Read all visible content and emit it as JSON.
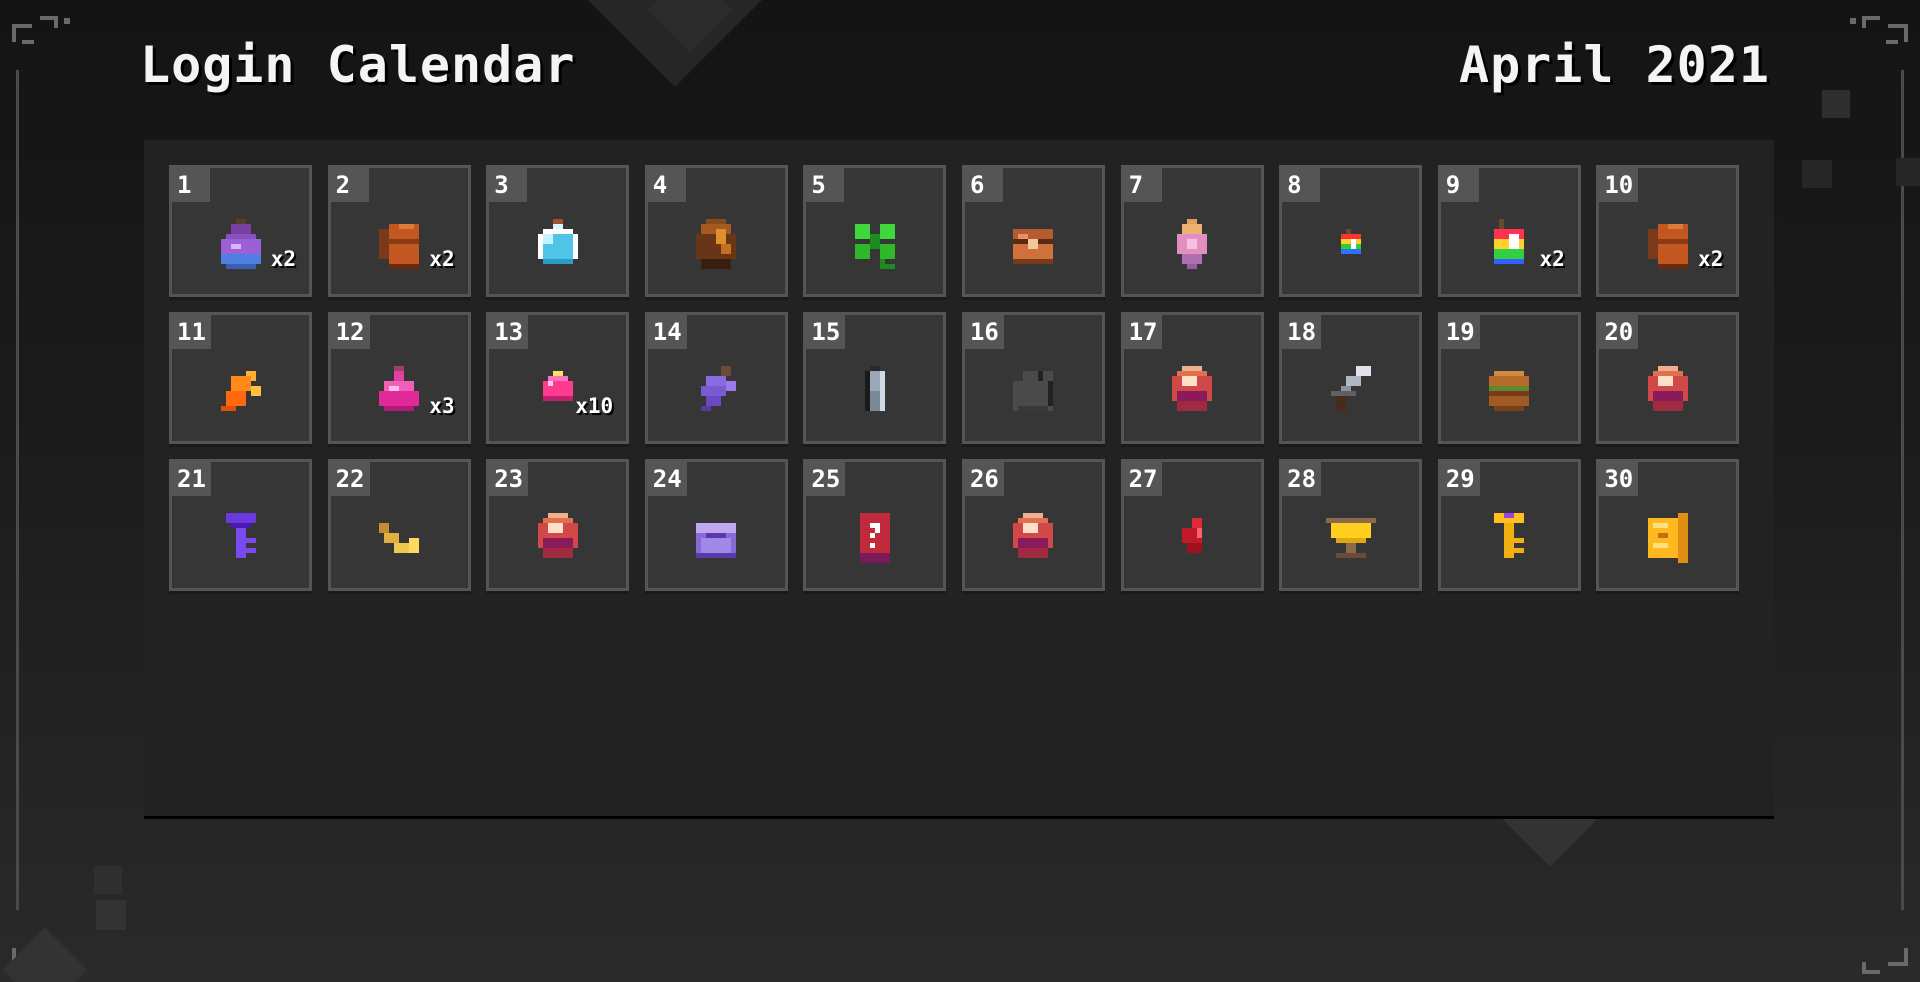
{
  "header": {
    "title": "Login Calendar",
    "month": "April 2021"
  },
  "days": [
    {
      "day": "1",
      "icon": "purple-potion-icon",
      "qty": "x2"
    },
    {
      "day": "2",
      "icon": "leather-backpack-icon",
      "qty": "x2"
    },
    {
      "day": "3",
      "icon": "blue-potion-icon",
      "qty": ""
    },
    {
      "day": "4",
      "icon": "brown-egg-icon",
      "qty": ""
    },
    {
      "day": "5",
      "icon": "four-leaf-clover-icon",
      "qty": ""
    },
    {
      "day": "6",
      "icon": "treasure-chest-icon",
      "qty": ""
    },
    {
      "day": "7",
      "icon": "pink-egg-icon",
      "qty": ""
    },
    {
      "day": "8",
      "icon": "small-rainbow-dye-icon",
      "qty": ""
    },
    {
      "day": "9",
      "icon": "rainbow-dye-icon",
      "qty": "x2"
    },
    {
      "day": "10",
      "icon": "leather-backpack-icon",
      "qty": "x2"
    },
    {
      "day": "11",
      "icon": "orange-feather-icon",
      "qty": ""
    },
    {
      "day": "12",
      "icon": "pink-potion-icon",
      "qty": "x3"
    },
    {
      "day": "13",
      "icon": "small-potion-icon",
      "qty": "x10"
    },
    {
      "day": "14",
      "icon": "purple-grapes-icon",
      "qty": ""
    },
    {
      "day": "15",
      "icon": "glass-vial-icon",
      "qty": ""
    },
    {
      "day": "16",
      "icon": "gray-cloak-icon",
      "qty": ""
    },
    {
      "day": "17",
      "icon": "red-orb-icon",
      "qty": ""
    },
    {
      "day": "18",
      "icon": "sword-icon",
      "qty": ""
    },
    {
      "day": "19",
      "icon": "burger-icon",
      "qty": ""
    },
    {
      "day": "20",
      "icon": "red-orb-icon",
      "qty": ""
    },
    {
      "day": "21",
      "icon": "purple-key-icon",
      "qty": ""
    },
    {
      "day": "22",
      "icon": "golden-horn-icon",
      "qty": ""
    },
    {
      "day": "23",
      "icon": "red-orb-icon",
      "qty": ""
    },
    {
      "day": "24",
      "icon": "purple-chest-icon",
      "qty": ""
    },
    {
      "day": "25",
      "icon": "mystery-card-icon",
      "qty": ""
    },
    {
      "day": "26",
      "icon": "red-orb-icon",
      "qty": ""
    },
    {
      "day": "27",
      "icon": "red-crystal-icon",
      "qty": ""
    },
    {
      "day": "28",
      "icon": "golden-trophy-icon",
      "qty": ""
    },
    {
      "day": "29",
      "icon": "golden-key-icon",
      "qty": ""
    },
    {
      "day": "30",
      "icon": "golden-scroll-icon",
      "qty": ""
    }
  ]
}
